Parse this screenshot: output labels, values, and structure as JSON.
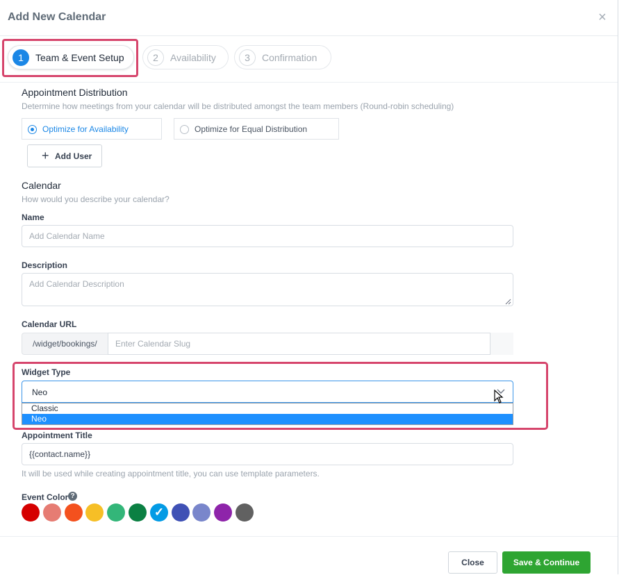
{
  "modal": {
    "title": "Add New Calendar",
    "close_icon": "close-icon"
  },
  "steps": [
    {
      "number": "1",
      "label": "Team & Event Setup",
      "active": true
    },
    {
      "number": "2",
      "label": "Availability",
      "active": false
    },
    {
      "number": "3",
      "label": "Confirmation",
      "active": false
    }
  ],
  "distribution": {
    "title": "Appointment Distribution",
    "subtitle": "Determine how meetings from your calendar will be distributed amongst the team members (Round-robin scheduling)",
    "options": [
      {
        "label": "Optimize for Availability",
        "selected": true
      },
      {
        "label": "Optimize for Equal Distribution",
        "selected": false
      }
    ],
    "add_user_label": "Add User"
  },
  "calendar": {
    "title": "Calendar",
    "subtitle": "How would you describe your calendar?",
    "name_label": "Name",
    "name_placeholder": "Add Calendar Name",
    "description_label": "Description",
    "description_placeholder": "Add Calendar Description",
    "url_label": "Calendar URL",
    "url_prefix": "/widget/bookings/",
    "url_placeholder": "Enter Calendar Slug",
    "widget_label": "Widget Type",
    "widget_value": "Neo",
    "widget_options": [
      {
        "label": "Classic",
        "selected": false
      },
      {
        "label": "Neo",
        "selected": true
      }
    ],
    "appointment_title_label": "Appointment Title",
    "appointment_title_value": "{{contact.name}}",
    "appointment_title_hint": "It will be used while creating appointment title, you can use template parameters.",
    "event_color_label": "Event Color",
    "event_colors": [
      "#d50000",
      "#e67c73",
      "#f4511e",
      "#f6bf26",
      "#33b679",
      "#0b8043",
      "#039be5",
      "#3f51b5",
      "#7986cb",
      "#8e24aa",
      "#616161"
    ],
    "selected_color": "#039be5"
  },
  "footer": {
    "close_label": "Close",
    "save_label": "Save & Continue"
  }
}
